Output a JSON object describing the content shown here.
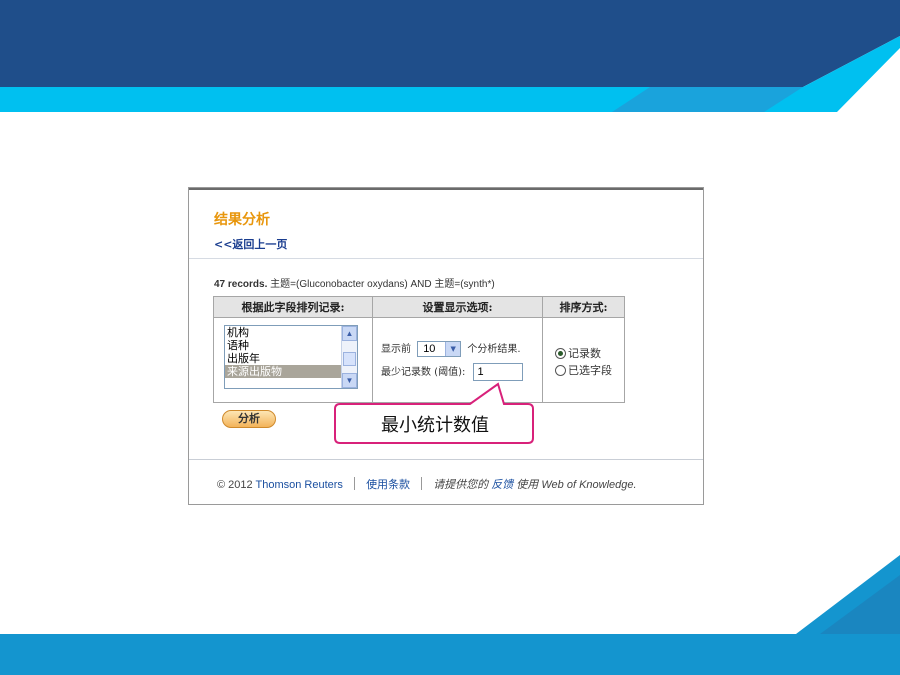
{
  "colors": {
    "top_band": "#1f4e8a",
    "top_stripe": "#00c0f0",
    "bottom_band": "#1495cf",
    "title_orange": "#e8960c",
    "link_blue": "#1a3d8f",
    "callout_border": "#d8217a"
  },
  "panel": {
    "title": "结果分析",
    "back_link": "<<返回上一页",
    "query_count": "47 records.",
    "query_text": " 主题=(Gluconobacter oxydans) AND 主题=(synth*)"
  },
  "table": {
    "headers": [
      "根据此字段排列记录:",
      "设置显示选项:",
      "排序方式:"
    ],
    "field_list": {
      "items": [
        "机构",
        "语种",
        "出版年",
        "来源出版物"
      ],
      "selected": "来源出版物",
      "scroll_up_icon": "arrow-up-icon",
      "scroll_down_icon": "arrow-down-icon"
    },
    "display_options": {
      "show_prefix": "显示前",
      "show_value": "10",
      "show_suffix": "个分析结果.",
      "min_label": "最少记录数 (阈值):",
      "min_value": "1"
    },
    "sort": {
      "options": [
        "记录数",
        "已选字段"
      ],
      "selected": "记录数"
    }
  },
  "analyze_button": "分析",
  "footer": {
    "copyright": "© 2012 ",
    "company": "Thomson Reuters",
    "terms": "使用条款",
    "feedback_prefix": "请提供您的 ",
    "feedback_link": "反馈",
    "feedback_suffix": " 使用 Web of Knowledge."
  },
  "callout": {
    "text": "最小统计数值"
  }
}
